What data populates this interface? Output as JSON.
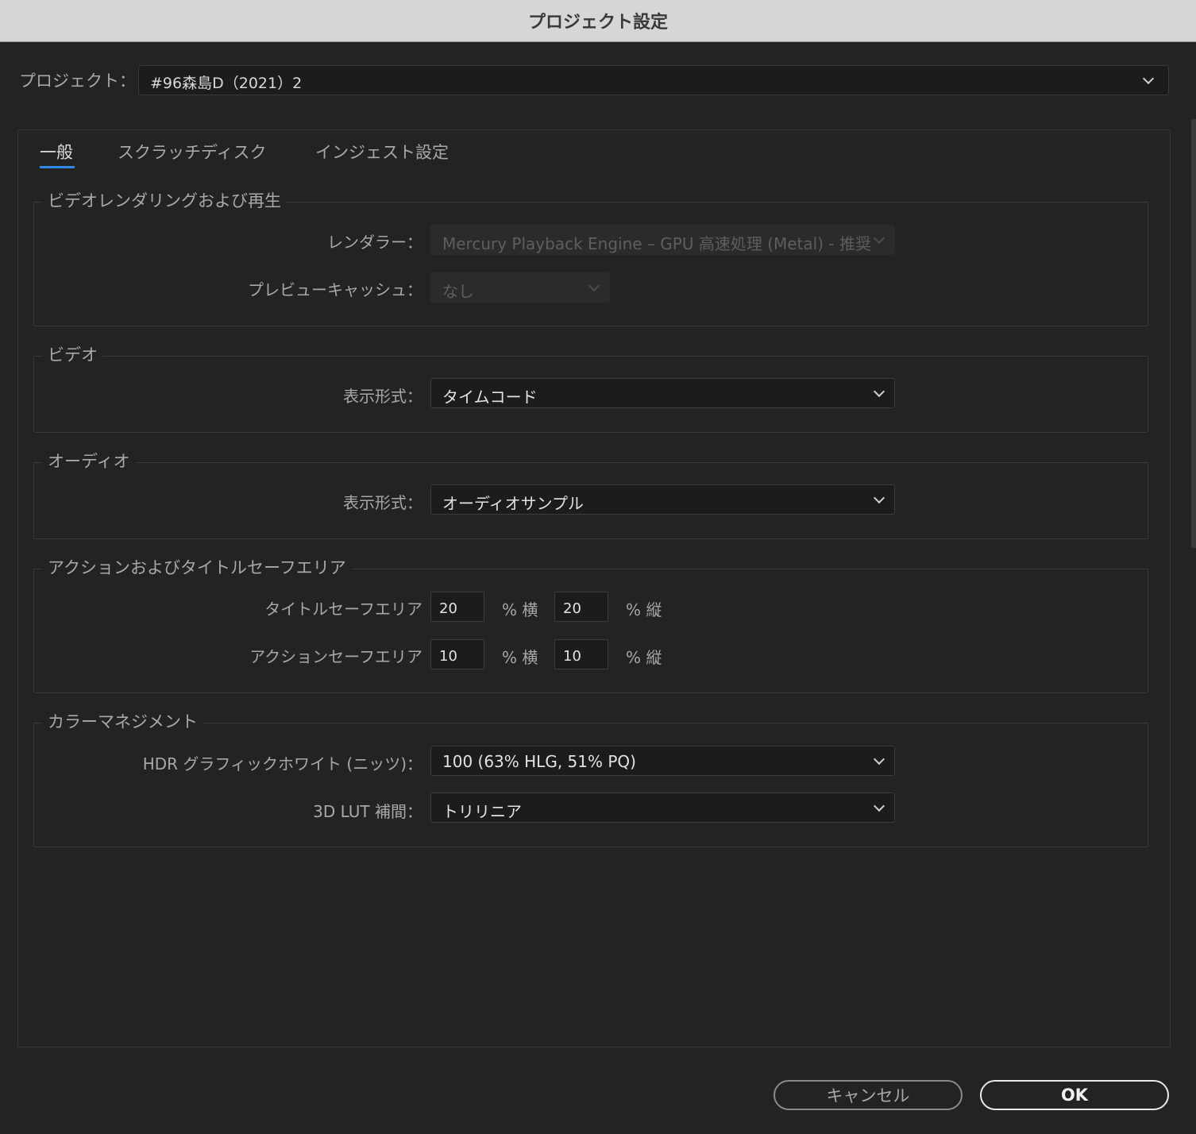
{
  "window": {
    "title": "プロジェクト設定"
  },
  "project": {
    "label": "プロジェクト：",
    "value": "#96森島D（2021）2"
  },
  "tabs": [
    {
      "label": "一般",
      "active": true
    },
    {
      "label": "スクラッチディスク",
      "active": false
    },
    {
      "label": "インジェスト設定",
      "active": false
    }
  ],
  "sections": {
    "video_rendering": {
      "title": "ビデオレンダリングおよび再生",
      "renderer_label": "レンダラー：",
      "renderer_value": "Mercury Playback Engine – GPU 高速処理 (Metal) - 推奨",
      "preview_cache_label": "プレビューキャッシュ：",
      "preview_cache_value": "なし"
    },
    "video": {
      "title": "ビデオ",
      "display_format_label": "表示形式：",
      "display_format_value": "タイムコード"
    },
    "audio": {
      "title": "オーディオ",
      "display_format_label": "表示形式：",
      "display_format_value": "オーディオサンプル"
    },
    "safe_areas": {
      "title": "アクションおよびタイトルセーフエリア",
      "title_safe_label": "タイトルセーフエリア",
      "title_safe_h": "20",
      "title_safe_v": "20",
      "action_safe_label": "アクションセーフエリア",
      "action_safe_h": "10",
      "action_safe_v": "10",
      "unit_h": "% 横",
      "unit_v": "% 縦"
    },
    "color_management": {
      "title": "カラーマネジメント",
      "hdr_label": "HDR グラフィックホワイト (ニッツ)：",
      "hdr_value": "100 (63% HLG, 51% PQ)",
      "lut_label": "3D LUT 補間：",
      "lut_value": "トリリニア"
    }
  },
  "buttons": {
    "cancel": "キャンセル",
    "ok": "OK"
  },
  "colors": {
    "accent": "#2e8ce6",
    "background": "#232323",
    "titlebar": "#d6d6d6"
  }
}
